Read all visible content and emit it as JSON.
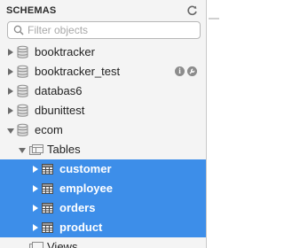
{
  "header": {
    "title": "SCHEMAS",
    "refresh_icon": "refresh-icon"
  },
  "search": {
    "placeholder": "Filter objects",
    "value": ""
  },
  "tree": {
    "schemas": [
      {
        "label": "booktracker",
        "expanded": false
      },
      {
        "label": "booktracker_test",
        "expanded": false,
        "actions": [
          "info-icon",
          "wrench-icon"
        ]
      },
      {
        "label": "databas6",
        "expanded": false
      },
      {
        "label": "dbunittest",
        "expanded": false
      },
      {
        "label": "ecom",
        "expanded": true
      }
    ],
    "folder": {
      "label": "Tables",
      "expanded": true
    },
    "tables": [
      {
        "label": "customer",
        "selected": true
      },
      {
        "label": "employee",
        "selected": true
      },
      {
        "label": "orders",
        "selected": true
      },
      {
        "label": "product",
        "selected": true
      }
    ],
    "partial_folder": {
      "label": "Views"
    }
  },
  "colors": {
    "selection": "#3d8ee9",
    "panel_bg": "#f4f4f4",
    "text": "#1f1f1f"
  }
}
